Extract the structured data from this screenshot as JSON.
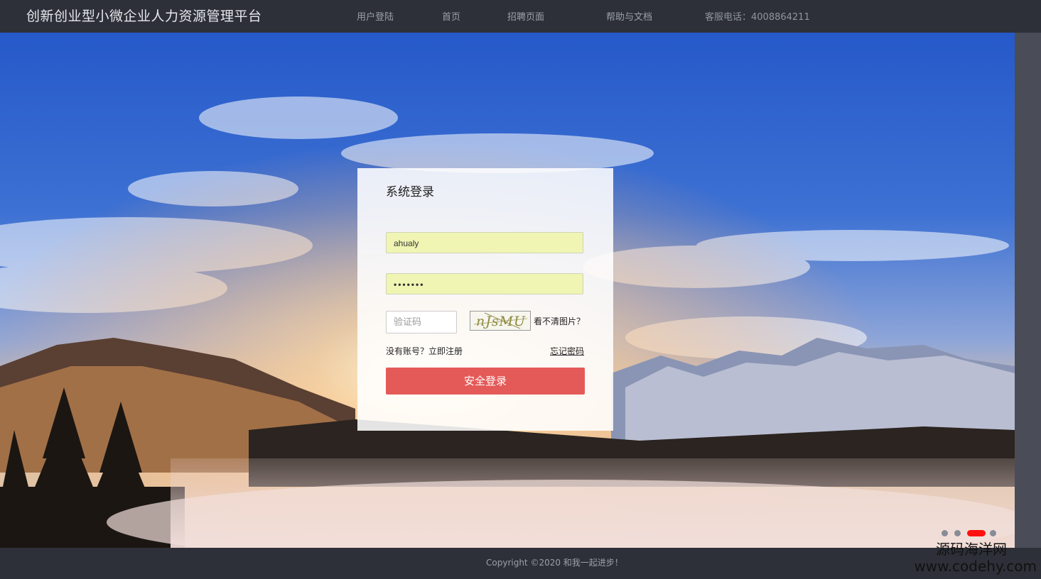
{
  "header": {
    "brand": "创新创业型小微企业人力资源管理平台",
    "nav": {
      "login": "用户登陆",
      "home": "首页",
      "recruit": "招聘页面",
      "help": "帮助与文档",
      "phone": "客服电话：4008864211"
    }
  },
  "login": {
    "title": "系统登录",
    "username_value": "ahualy",
    "password_value": "•••••••",
    "captcha_placeholder": "验证码",
    "captcha_text": "nJsMU",
    "refresh_label": "看不清图片？",
    "register_label": "没有账号？立即注册",
    "forgot_label": "忘记密码",
    "submit_label": "安全登录"
  },
  "slider": {
    "dot_count": 4,
    "active_index": 2
  },
  "footer": {
    "copyright": "Copyright ©2020 和我一起进步！"
  },
  "watermark": {
    "cn": "源码海洋网",
    "url": "www.codehy.com"
  },
  "colors": {
    "header_bg": "#2d3038",
    "login_button": "#e45a58",
    "input_autofill": "#f0f5b3",
    "active_dot": "#ff1010"
  }
}
